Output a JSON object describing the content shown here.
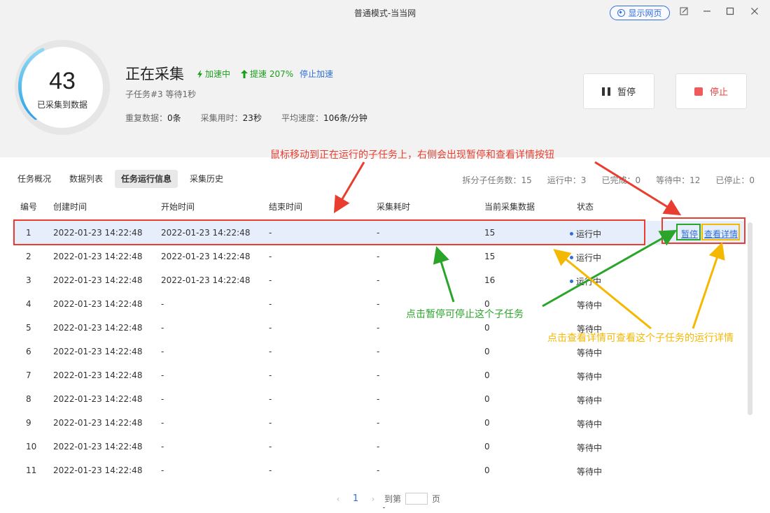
{
  "window": {
    "title": "普通模式-当当网",
    "show_web_label": "显示网页",
    "edit_icon": "edit-icon",
    "min_icon": "minimize-icon",
    "max_icon": "maximize-icon",
    "close_icon": "close-icon"
  },
  "progress": {
    "count": "43",
    "label": "已采集到数据",
    "status_title": "正在采集",
    "accel_label": "加速中",
    "speedup_label": "提速 207%",
    "stop_accel_label": "停止加速",
    "subtask_status": "子任务#3 等待1秒",
    "dup_label": "重复数据：",
    "dup_value": "0条",
    "time_label": "采集用时：",
    "time_value": "23秒",
    "speed_label": "平均速度：",
    "speed_value": "106条/分钟",
    "pause_label": "暂停",
    "stop_label": "停止"
  },
  "tabs": [
    {
      "label": "任务概况",
      "active": false
    },
    {
      "label": "数据列表",
      "active": false
    },
    {
      "label": "任务运行信息",
      "active": true
    },
    {
      "label": "采集历史",
      "active": false
    }
  ],
  "counters": [
    "拆分子任务数：15",
    "运行中：3",
    "已完成：0",
    "等待中：12",
    "已停止：0"
  ],
  "table": {
    "headers": [
      "编号",
      "创建时间",
      "开始时间",
      "结束时间",
      "采集耗时",
      "当前采集数据",
      "状态"
    ],
    "rows": [
      {
        "id": "1",
        "created": "2022-01-23 14:22:48",
        "start": "2022-01-23 14:22:48",
        "end": "-",
        "elapsed": "-",
        "count": "15",
        "status": "运行中",
        "running": true
      },
      {
        "id": "2",
        "created": "2022-01-23 14:22:48",
        "start": "2022-01-23 14:22:48",
        "end": "-",
        "elapsed": "-",
        "count": "15",
        "status": "运行中",
        "running": true
      },
      {
        "id": "3",
        "created": "2022-01-23 14:22:48",
        "start": "2022-01-23 14:22:48",
        "end": "-",
        "elapsed": "-",
        "count": "16",
        "status": "运行中",
        "running": true
      },
      {
        "id": "4",
        "created": "2022-01-23 14:22:48",
        "start": "-",
        "end": "-",
        "elapsed": "-",
        "count": "0",
        "status": "等待中",
        "running": false
      },
      {
        "id": "5",
        "created": "2022-01-23 14:22:48",
        "start": "-",
        "end": "-",
        "elapsed": "-",
        "count": "0",
        "status": "等待中",
        "running": false
      },
      {
        "id": "6",
        "created": "2022-01-23 14:22:48",
        "start": "-",
        "end": "-",
        "elapsed": "-",
        "count": "0",
        "status": "等待中",
        "running": false
      },
      {
        "id": "7",
        "created": "2022-01-23 14:22:48",
        "start": "-",
        "end": "-",
        "elapsed": "-",
        "count": "0",
        "status": "等待中",
        "running": false
      },
      {
        "id": "8",
        "created": "2022-01-23 14:22:48",
        "start": "-",
        "end": "-",
        "elapsed": "-",
        "count": "0",
        "status": "等待中",
        "running": false
      },
      {
        "id": "9",
        "created": "2022-01-23 14:22:48",
        "start": "-",
        "end": "-",
        "elapsed": "-",
        "count": "0",
        "status": "等待中",
        "running": false
      },
      {
        "id": "10",
        "created": "2022-01-23 14:22:48",
        "start": "-",
        "end": "-",
        "elapsed": "-",
        "count": "0",
        "status": "等待中",
        "running": false
      },
      {
        "id": "11",
        "created": "2022-01-23 14:22:48",
        "start": "-",
        "end": "-",
        "elapsed": "-",
        "count": "0",
        "status": "等待中",
        "running": false
      }
    ],
    "row_actions": {
      "pause": "暂停",
      "detail": "查看详情"
    }
  },
  "pager": {
    "prev_icon": "chevron-left-icon",
    "current": "1",
    "next_icon": "chevron-right-icon",
    "goto_label": "到第",
    "page_label": "页"
  },
  "annotations": {
    "red": "鼠标移动到正在运行的子任务上，右侧会出现暂停和查看详情按钮",
    "green": "点击暂停可停止这个子任务",
    "yellow": "点击查看详情可查看这个子任务的运行详情"
  },
  "colors": {
    "accent": "#2f6fdc",
    "running_green": "#1aa01a",
    "stop_red": "#f05a5a",
    "annot_red": "#e83d2f",
    "annot_green": "#2aa52a",
    "annot_yellow": "#f5b800",
    "highlight_row": "#e6eefb"
  }
}
